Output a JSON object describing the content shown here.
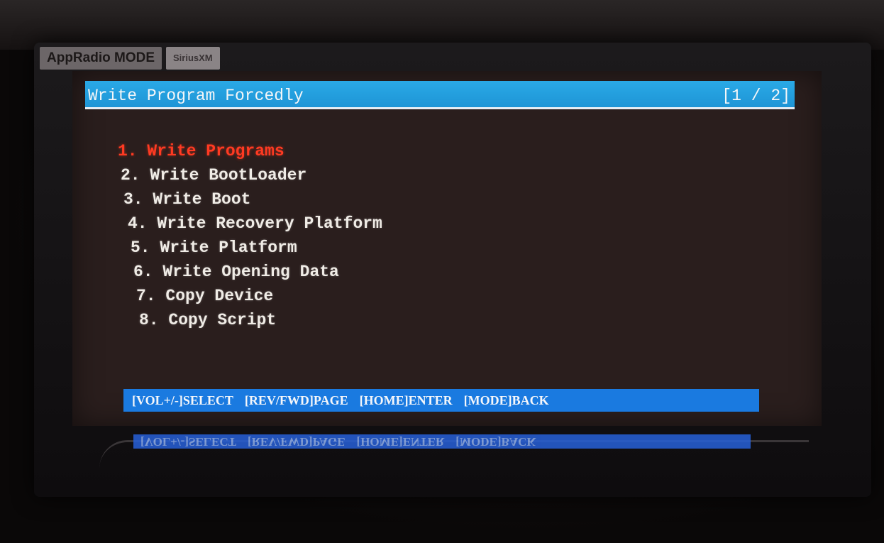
{
  "device": {
    "mode_tabs": [
      "AppRadio MODE",
      "SiriusXM"
    ]
  },
  "screen": {
    "title": "Write Program Forcedly",
    "page_indicator": "[1 / 2]",
    "selected_index": 0,
    "menu_items": [
      "1. Write Programs",
      "2. Write BootLoader",
      "3. Write Boot",
      "4. Write Recovery Platform",
      "5. Write Platform",
      "6. Write Opening Data",
      "7. Copy Device",
      "8. Copy Script"
    ],
    "help_bar": [
      "[VOL+/-]SELECT",
      "[REV/FWD]PAGE",
      "[HOME]ENTER",
      "[MODE]BACK"
    ]
  },
  "colors": {
    "title_bar": "#1e95d6",
    "help_bar": "#1a7ae0",
    "selected_item": "#ff3a22",
    "menu_text": "#f0ece6",
    "screen_background": "#2a1e1d"
  }
}
